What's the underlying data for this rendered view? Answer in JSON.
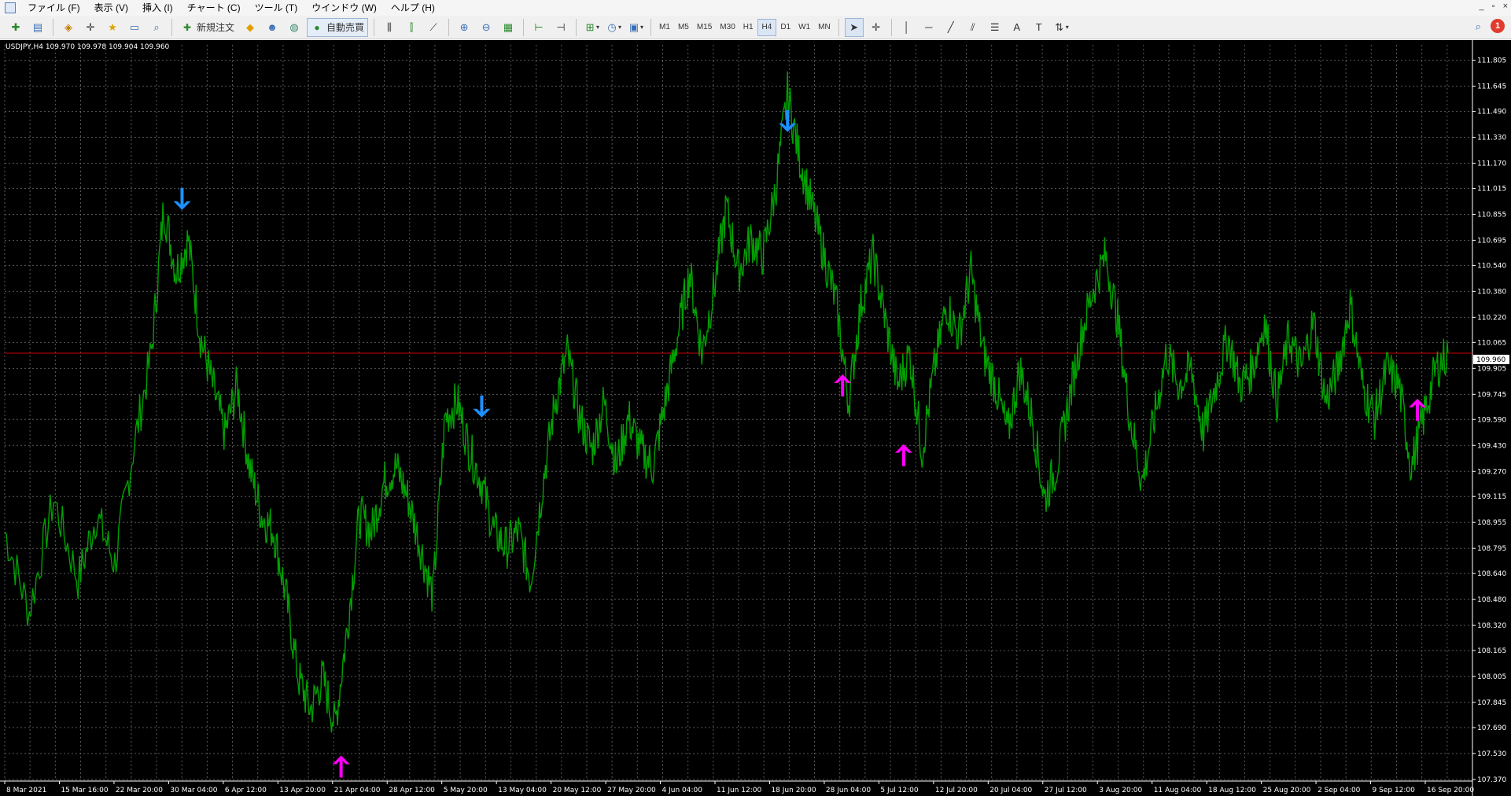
{
  "menu": {
    "items": [
      "ファイル (F)",
      "表示 (V)",
      "挿入 (I)",
      "チャート (C)",
      "ツール (T)",
      "ウインドウ (W)",
      "ヘルプ (H)"
    ],
    "window_controls": [
      "_",
      "▫",
      "×"
    ]
  },
  "toolbar": {
    "new_order_label": "新規注文",
    "auto_trade_label": "自動売買",
    "timeframes": [
      "M1",
      "M5",
      "M15",
      "M30",
      "H1",
      "H4",
      "D1",
      "W1",
      "MN"
    ],
    "active_timeframe": "H4",
    "notification_count": "1"
  },
  "chart": {
    "symbol_info": "USDJPY,H4  109.970 109.978 109.904 109.960",
    "current_price_label": "109.960",
    "colors": {
      "background": "#000000",
      "price_line": "#00a000",
      "grid": "#5a5a5a",
      "current_price_line": "#cc0000",
      "up_arrow": "#ff00ff",
      "down_arrow": "#1e90ff",
      "axis_text": "#ffffff"
    }
  },
  "chart_data": {
    "type": "line",
    "ylim": [
      107.37,
      111.9
    ],
    "y_ticks": [
      "111.805",
      "111.645",
      "111.490",
      "111.330",
      "111.170",
      "111.015",
      "110.855",
      "110.695",
      "110.540",
      "110.380",
      "110.220",
      "110.065",
      "109.905",
      "109.745",
      "109.590",
      "109.430",
      "109.270",
      "109.115",
      "108.955",
      "108.795",
      "108.640",
      "108.480",
      "108.320",
      "108.165",
      "108.005",
      "107.845",
      "107.690",
      "107.530",
      "107.370"
    ],
    "x_ticks": [
      "8 Mar 2021",
      "15 Mar 16:00",
      "22 Mar 20:00",
      "30 Mar 04:00",
      "6 Apr 12:00",
      "13 Apr 20:00",
      "21 Apr 04:00",
      "28 Apr 12:00",
      "5 May 20:00",
      "13 May 04:00",
      "20 May 12:00",
      "27 May 20:00",
      "4 Jun 04:00",
      "11 Jun 12:00",
      "18 Jun 20:00",
      "28 Jun 04:00",
      "5 Jul 12:00",
      "12 Jul 20:00",
      "20 Jul 04:00",
      "27 Jul 12:00",
      "3 Aug 20:00",
      "11 Aug 04:00",
      "18 Aug 12:00",
      "25 Aug 20:00",
      "2 Sep 04:00",
      "9 Sep 12:00",
      "16 Sep 20:00"
    ],
    "current_price": 109.96,
    "series": [
      {
        "name": "USDJPY,H4",
        "points": [
          [
            0,
            108.9
          ],
          [
            4,
            108.4
          ],
          [
            8,
            109.1
          ],
          [
            12,
            108.6
          ],
          [
            15,
            109.0
          ],
          [
            18,
            108.7
          ],
          [
            21,
            109.4
          ],
          [
            24,
            110.0
          ],
          [
            26,
            110.9
          ],
          [
            28,
            110.5
          ],
          [
            30,
            110.7
          ],
          [
            32,
            110.1
          ],
          [
            34,
            109.8
          ],
          [
            36,
            109.5
          ],
          [
            38,
            109.8
          ],
          [
            40,
            109.3
          ],
          [
            42,
            109.0
          ],
          [
            44,
            108.9
          ],
          [
            46,
            108.5
          ],
          [
            48,
            108.0
          ],
          [
            50,
            107.8
          ],
          [
            52,
            108.0
          ],
          [
            54,
            107.7
          ],
          [
            56,
            108.3
          ],
          [
            58,
            109.0
          ],
          [
            60,
            108.9
          ],
          [
            62,
            109.2
          ],
          [
            64,
            109.3
          ],
          [
            66,
            109.1
          ],
          [
            68,
            108.8
          ],
          [
            70,
            108.5
          ],
          [
            72,
            109.6
          ],
          [
            74,
            109.7
          ],
          [
            76,
            109.4
          ],
          [
            78,
            109.2
          ],
          [
            80,
            108.9
          ],
          [
            82,
            108.8
          ],
          [
            84,
            108.9
          ],
          [
            86,
            108.6
          ],
          [
            88,
            109.2
          ],
          [
            90,
            109.7
          ],
          [
            92,
            110.0
          ],
          [
            94,
            109.6
          ],
          [
            96,
            109.4
          ],
          [
            98,
            109.7
          ],
          [
            100,
            109.3
          ],
          [
            102,
            109.6
          ],
          [
            104,
            109.4
          ],
          [
            106,
            109.3
          ],
          [
            108,
            109.7
          ],
          [
            110,
            110.1
          ],
          [
            112,
            110.5
          ],
          [
            114,
            110.0
          ],
          [
            116,
            110.4
          ],
          [
            118,
            110.9
          ],
          [
            120,
            110.5
          ],
          [
            122,
            110.7
          ],
          [
            124,
            110.6
          ],
          [
            126,
            111.0
          ],
          [
            128,
            111.6
          ],
          [
            130,
            111.2
          ],
          [
            132,
            110.9
          ],
          [
            134,
            110.6
          ],
          [
            136,
            110.3
          ],
          [
            138,
            109.7
          ],
          [
            140,
            110.3
          ],
          [
            142,
            110.6
          ],
          [
            144,
            110.2
          ],
          [
            146,
            109.8
          ],
          [
            148,
            110.0
          ],
          [
            150,
            109.4
          ],
          [
            152,
            109.9
          ],
          [
            154,
            110.3
          ],
          [
            156,
            110.1
          ],
          [
            158,
            110.5
          ],
          [
            160,
            110.0
          ],
          [
            162,
            109.8
          ],
          [
            164,
            109.5
          ],
          [
            166,
            109.9
          ],
          [
            168,
            109.6
          ],
          [
            170,
            109.1
          ],
          [
            172,
            109.3
          ],
          [
            174,
            109.7
          ],
          [
            176,
            110.1
          ],
          [
            178,
            110.4
          ],
          [
            180,
            110.6
          ],
          [
            182,
            110.2
          ],
          [
            184,
            109.6
          ],
          [
            186,
            109.2
          ],
          [
            188,
            109.6
          ],
          [
            190,
            110.0
          ],
          [
            192,
            109.8
          ],
          [
            194,
            109.9
          ],
          [
            196,
            109.5
          ],
          [
            198,
            109.8
          ],
          [
            200,
            110.1
          ],
          [
            202,
            109.8
          ],
          [
            204,
            109.9
          ],
          [
            206,
            110.2
          ],
          [
            208,
            109.7
          ],
          [
            210,
            110.1
          ],
          [
            212,
            109.9
          ],
          [
            214,
            110.2
          ],
          [
            216,
            109.7
          ],
          [
            218,
            109.9
          ],
          [
            220,
            110.3
          ],
          [
            222,
            109.8
          ],
          [
            224,
            109.6
          ],
          [
            226,
            109.9
          ],
          [
            228,
            109.8
          ],
          [
            230,
            109.3
          ],
          [
            232,
            109.6
          ],
          [
            234,
            109.9
          ],
          [
            236,
            110.0
          ]
        ]
      }
    ],
    "signals": [
      {
        "type": "down",
        "x": 29,
        "y": 110.95
      },
      {
        "type": "up",
        "x": 55,
        "y": 107.45
      },
      {
        "type": "down",
        "x": 78,
        "y": 109.67
      },
      {
        "type": "down",
        "x": 128,
        "y": 111.43
      },
      {
        "type": "up",
        "x": 137,
        "y": 109.8
      },
      {
        "type": "up",
        "x": 147,
        "y": 109.37
      },
      {
        "type": "up",
        "x": 231,
        "y": 109.65
      }
    ]
  }
}
